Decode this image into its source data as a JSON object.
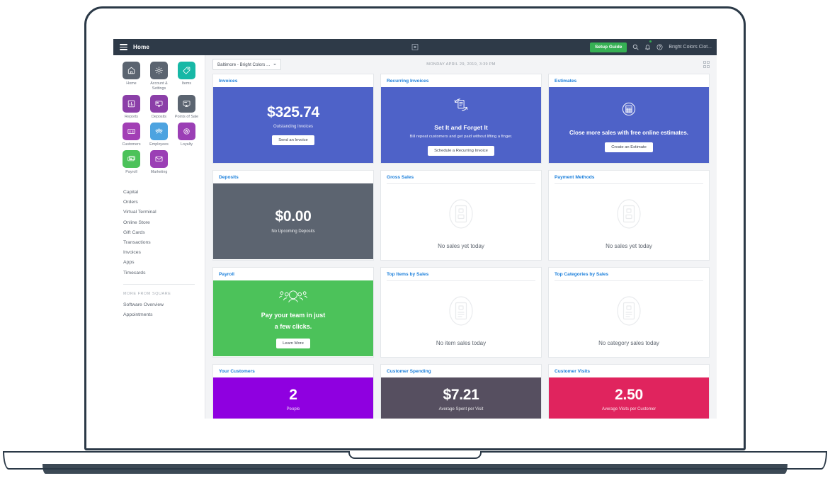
{
  "topbar": {
    "title": "Home",
    "menu_icon": "hamburger-icon",
    "center_icon": "square-icon",
    "setup_guide_label": "Setup Guide",
    "search_icon": "search-icon",
    "bell_icon": "bell-icon",
    "help_icon": "help-circle-icon",
    "account_name": "Bright Colors Clot..."
  },
  "sidebar": {
    "tiles": [
      {
        "label": "Home",
        "icon": "home-icon",
        "color": "#5b6470"
      },
      {
        "label": "Account & Settings",
        "icon": "gear-icon",
        "color": "#5b6470"
      },
      {
        "label": "Items",
        "icon": "tag-icon",
        "color": "#17b8a6"
      },
      {
        "label": "Reports",
        "icon": "bar-chart-icon",
        "color": "#8b3fa8"
      },
      {
        "label": "Deposits",
        "icon": "deposit-icon",
        "color": "#8b3fa8"
      },
      {
        "label": "Points of Sale",
        "icon": "monitor-icon",
        "color": "#5b6470"
      },
      {
        "label": "Customers",
        "icon": "id-card-icon",
        "color": "#a23fb5"
      },
      {
        "label": "Employees",
        "icon": "people-icon",
        "color": "#4da3e0"
      },
      {
        "label": "Loyalty",
        "icon": "star-badge-icon",
        "color": "#9b3fb5"
      },
      {
        "label": "Payroll",
        "icon": "money-icon",
        "color": "#4cc25a"
      },
      {
        "label": "Marketing",
        "icon": "envelope-icon",
        "color": "#9b3fb5"
      }
    ],
    "nav_items": [
      "Capital",
      "Orders",
      "Virtual Terminal",
      "Online Store",
      "Gift Cards",
      "Transactions",
      "Invoices",
      "Apps",
      "Timecards"
    ],
    "section_title": "MORE FROM SQUARE",
    "section_items": [
      "Software Overview",
      "Appointments"
    ]
  },
  "toolbar": {
    "location": "Baltimore - Bright Colors ...",
    "date": "MONDAY APRIL 29, 2019, 3:39 PM",
    "grid_toggle_icon": "grid-2x2-icon"
  },
  "cards": [
    {
      "title": "Invoices",
      "kind": "metric",
      "bg": "#4e62c8",
      "amount": "$325.74",
      "caption": "Outstanding Invoices",
      "button": "Send an Invoice"
    },
    {
      "title": "Recurring Invoices",
      "kind": "promo",
      "bg": "#4e62c8",
      "icon": "recurring-invoice-icon",
      "headline": "Set It and Forget It",
      "subtext": "Bill repeat customers and get paid without lifting a finger.",
      "button": "Schedule a Recurring Invoice"
    },
    {
      "title": "Estimates",
      "kind": "promo",
      "bg": "#4e62c8",
      "icon": "calculator-icon",
      "headline": "Close more sales with free online estimates.",
      "button": "Create an Estimate"
    },
    {
      "title": "Deposits",
      "kind": "metric",
      "bg": "#5c6470",
      "amount": "$0.00",
      "caption": "No Upcoming Deposits"
    },
    {
      "title": "Gross Sales",
      "kind": "empty",
      "icon": "empty-receipt-icon",
      "empty_text": "No sales yet today"
    },
    {
      "title": "Payment Methods",
      "kind": "empty",
      "icon": "empty-receipt-icon",
      "empty_text": "No sales yet today"
    },
    {
      "title": "Payroll",
      "kind": "promo",
      "bg": "#4cc25a",
      "icon": "team-people-icon",
      "headline_line1": "Pay your team in just",
      "headline_line2": "a few clicks.",
      "button": "Learn More"
    },
    {
      "title": "Top Items by Sales",
      "kind": "empty",
      "icon": "empty-receipt-icon",
      "empty_text": "No item sales today"
    },
    {
      "title": "Top Categories by Sales",
      "kind": "empty",
      "icon": "empty-receipt-icon",
      "empty_text": "No category sales today"
    },
    {
      "title": "Your Customers",
      "kind": "metric",
      "bg": "#8f00e0",
      "amount": "2",
      "caption": "People"
    },
    {
      "title": "Customer Spending",
      "kind": "metric",
      "bg": "#564f60",
      "amount": "$7.21",
      "caption": "Average Spent per Visit"
    },
    {
      "title": "Customer Visits",
      "kind": "metric",
      "bg": "#e0245e",
      "amount": "2.50",
      "caption": "Average Visits per Customer"
    }
  ]
}
